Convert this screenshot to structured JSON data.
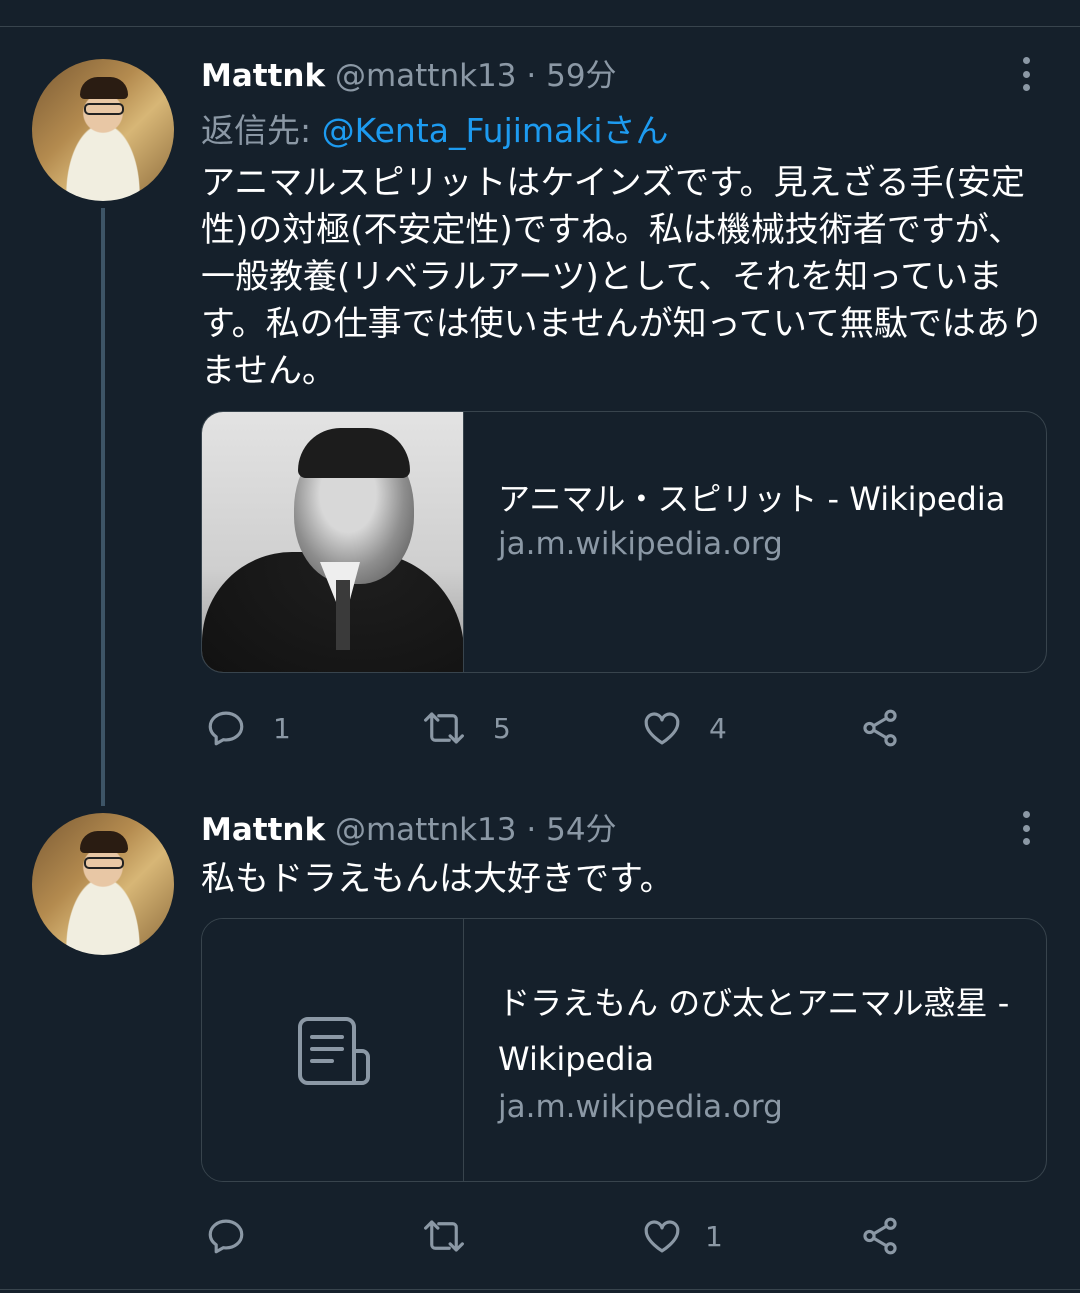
{
  "tweets": [
    {
      "name": "Mattnk",
      "handle": "@mattnk13",
      "time": "59分",
      "reply_label": "返信先: ",
      "reply_to": "@Kenta_Fujimakiさん",
      "text": "アニマルスピリットはケインズです。見えざる手(安定性)の対極(不安定性)ですね。私は機械技術者ですが、一般教養(リベラルアーツ)として、それを知っています。私の仕事では使いませんが知っていて無駄ではありません。",
      "card": {
        "title": "アニマル・スピリット - Wikipedia",
        "domain": "ja.m.wikipedia.org"
      },
      "actions": {
        "reply": "1",
        "retweet": "5",
        "like": "4"
      }
    },
    {
      "name": "Mattnk",
      "handle": "@mattnk13",
      "time": "54分",
      "text": "私もドラえもんは大好きです。",
      "card": {
        "title": "ドラえもん のび太とアニマル惑星 - Wikipedia",
        "domain": "ja.m.wikipedia.org"
      },
      "actions": {
        "reply": "",
        "retweet": "",
        "like": "1"
      }
    }
  ],
  "icons": [
    "more-icon",
    "reply-icon",
    "retweet-icon",
    "like-icon",
    "share-icon",
    "document-icon"
  ],
  "colors": {
    "background": "#15202b",
    "link": "#1d9bf0",
    "secondary_text": "#8b98a5",
    "border": "#38444d"
  }
}
